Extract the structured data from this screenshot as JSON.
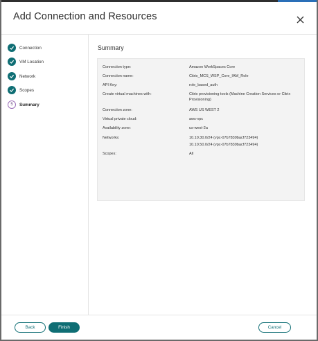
{
  "dialog": {
    "title": "Add Connection and Resources"
  },
  "steps": [
    {
      "label": "Connection",
      "status": "complete"
    },
    {
      "label": "VM Location",
      "status": "complete"
    },
    {
      "label": "Network",
      "status": "complete"
    },
    {
      "label": "Scopes",
      "status": "complete"
    },
    {
      "label": "Summary",
      "status": "current",
      "number": "5"
    }
  ],
  "summary": {
    "title": "Summary",
    "rows": [
      {
        "label": "Connection type:",
        "value": "Amazon WorkSpaces Core"
      },
      {
        "label": "Connection name:",
        "value": "Citrix_MCS_WSP_Core_IAM_Role"
      },
      {
        "label": "API Key:",
        "value": "role_based_auth"
      },
      {
        "label": "Create virtual machines with:",
        "value": "Citrix provisioning tools (Machine Creation Services or Citrix Provisioning)"
      },
      {
        "label": "Connection zone:",
        "value": "AWS US WEST 2"
      },
      {
        "label": "Virtual private cloud:",
        "value": "aws-vpc"
      },
      {
        "label": "Availability zone:",
        "value": "us-west-2a"
      },
      {
        "label": "Networks:",
        "value": "10.10.30.0/24 (vpc-07b7839bacf723494)",
        "value2": "10.10.50.0/24 (vpc-07b7839bacf723494)"
      },
      {
        "label": "Scopes:",
        "value": "All"
      }
    ]
  },
  "footer": {
    "back_label": "Back",
    "finish_label": "Finish",
    "cancel_label": "Cancel"
  },
  "colors": {
    "accent": "#0f6e74",
    "current_step_ring": "#9b6fb8",
    "summary_background": "#f3f3f3"
  },
  "icons": {
    "close": "close-icon",
    "step_complete": "checkmark-icon"
  }
}
